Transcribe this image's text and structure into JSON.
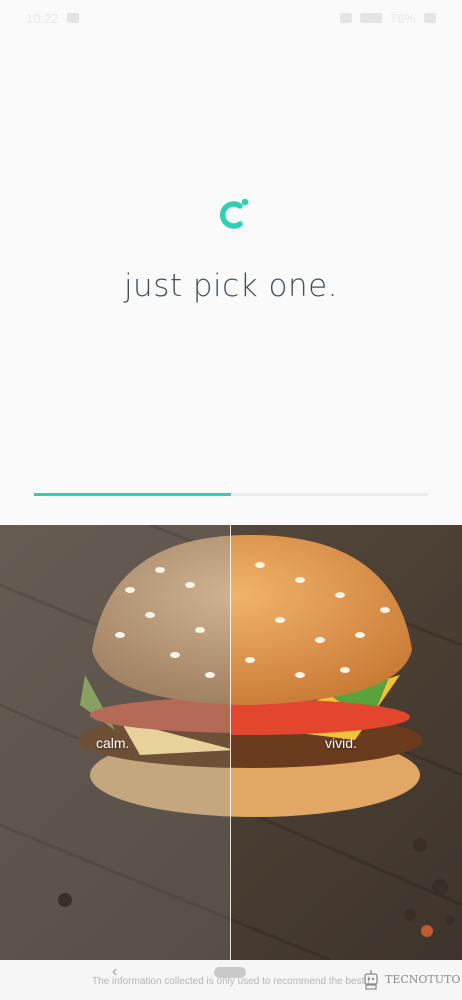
{
  "status_bar": {
    "time": "10:22",
    "battery": "76%"
  },
  "main": {
    "headline": "just pick one.",
    "progress": 0.5,
    "accent_color": "#2fd0b5"
  },
  "photo": {
    "left_label": "calm.",
    "right_label": "vivid."
  },
  "footer": {
    "disclaimer": "The information collected is only used to recommend the best f",
    "watermark": "TECNOTUTO"
  },
  "icons": [
    "app-logo-icon",
    "back-icon",
    "home-pill-icon",
    "watermark-robot-icon"
  ]
}
